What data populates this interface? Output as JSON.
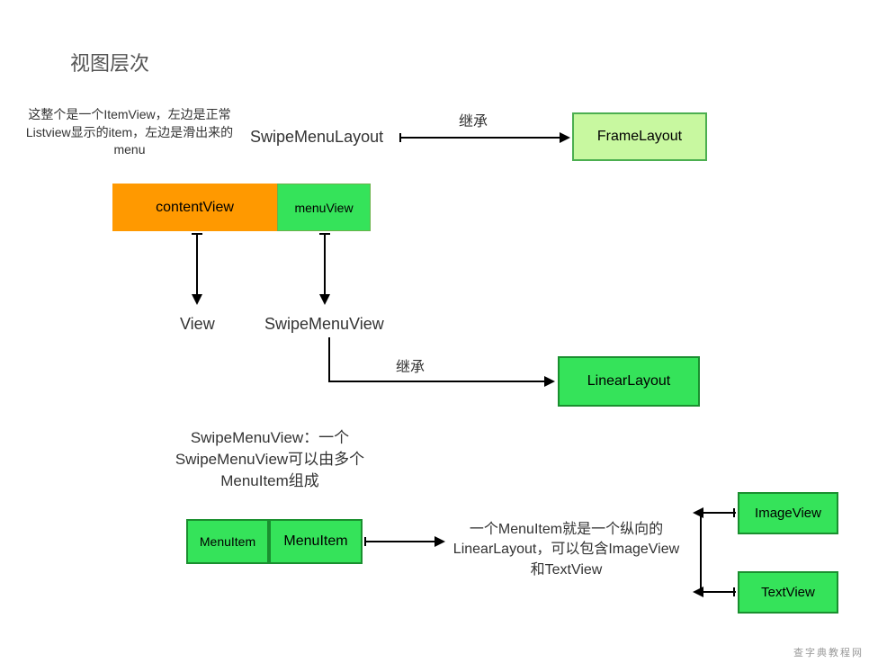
{
  "title": "视图层次",
  "note1": "这整个是一个ItemView，左边是正常Listview显示的item，左边是滑出来的menu",
  "swipeMenuLayout": "SwipeMenuLayout",
  "inherit1": "继承",
  "frameLayout": "FrameLayout",
  "contentView": "contentView",
  "menuView": "menuView",
  "viewLabel": "View",
  "swipeMenuViewLabel": "SwipeMenuView",
  "inherit2": "继承",
  "linearLayout": "LinearLayout",
  "swipeMenuViewDesc": "SwipeMenuView：一个SwipeMenuView可以由多个MenuItem组成",
  "menuItem1": "MenuItem",
  "menuItem2": "MenuItem",
  "menuItemDesc": "一个MenuItem就是一个纵向的LinearLayout，可以包含ImageView和TextView",
  "imageView": "ImageView",
  "textView": "TextView",
  "watermark": "查字典教程网"
}
